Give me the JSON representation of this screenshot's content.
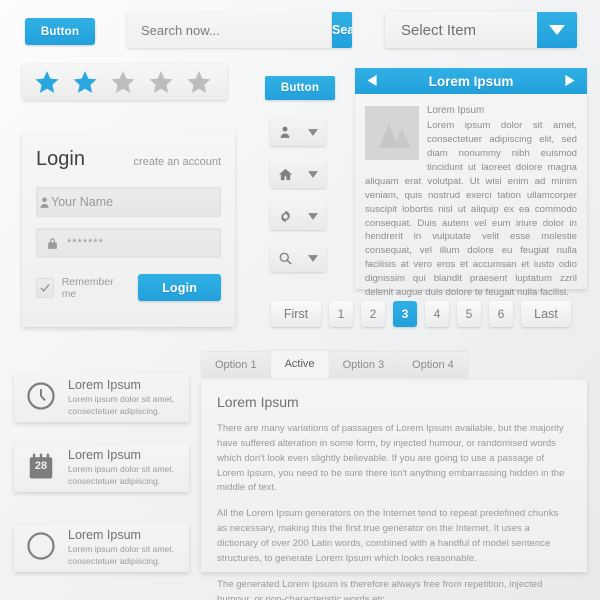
{
  "theme": {
    "accent": "#22a0db",
    "accent_light": "#31b0e4",
    "panel": "#f4f4f4",
    "text": "#8a8a8a"
  },
  "top_button": {
    "label": "Button"
  },
  "search": {
    "placeholder": "Search now...",
    "value": "",
    "button_label": "Search"
  },
  "select": {
    "value": "Select Item",
    "arrow_icon": "chevron-down-icon"
  },
  "rating": {
    "total": 5,
    "filled": 2
  },
  "second_button": {
    "label": "Button"
  },
  "login": {
    "title": "Login",
    "create_account": "create an account",
    "username": {
      "placeholder": "Your Name",
      "value": "",
      "icon": "user-icon"
    },
    "password": {
      "placeholder": "",
      "value": "*******",
      "icon": "lock-icon"
    },
    "remember_label": "Remember me",
    "remember_checked": true,
    "submit_label": "Login"
  },
  "icon_dropdowns": [
    {
      "icon": "user-icon",
      "name": "user-dropdown"
    },
    {
      "icon": "home-icon",
      "name": "home-dropdown"
    },
    {
      "icon": "gear-icon",
      "name": "settings-dropdown"
    },
    {
      "icon": "search-icon",
      "name": "search-dropdown"
    }
  ],
  "carousel": {
    "title": "Lorem Ipsum",
    "prev_icon": "caret-left-icon",
    "next_icon": "caret-right-icon",
    "item_title": "Lorem Ipsum",
    "lead": "Lorem ipsum dolor sit amet, consectetuer adipiscing elit, sed diam nonummy nibh euismod tincidunt ut laoreet dolore magna",
    "body": "aliquam erat volutpat. Ut wisi enim ad minim veniam, quis nostrud exerci tation ullamcorper suscipit lobortis nisl ut aliquip ex ea commodo consequat. Duis autem vel eum iriure dolor in hendrerit in vulputate velit esse molestie consequat, vel illum dolore eu feugiat nulla facilisis at vero eros et accumsan et iusto odio dignissim qui blandit praesent luptatum zzril delenit augue duis dolore te feugait nulla facilisi."
  },
  "pagination": {
    "first_label": "First",
    "last_label": "Last",
    "pages": [
      "1",
      "2",
      "3",
      "4",
      "5",
      "6"
    ],
    "active": "3"
  },
  "media_list": [
    {
      "icon": "clock-icon",
      "title": "Lorem Ipsum",
      "desc": "Lorem ipsum dolor sit amet, consectetuer adipiscing."
    },
    {
      "icon": "calendar-icon",
      "badge": "28",
      "title": "Lorem Ipsum",
      "desc": "Lorem ipsum dolor sit amet, consectetuer adipiscing."
    },
    {
      "icon": "compass-icon",
      "title": "Lorem Ipsum",
      "desc": "Lorem ipsum dolor sit amet, consectetuer adipiscing."
    }
  ],
  "tabs": {
    "items": [
      {
        "label": "Option 1",
        "active": false
      },
      {
        "label": "Active",
        "active": true
      },
      {
        "label": "Option 3",
        "active": false
      },
      {
        "label": "Option 4",
        "active": false
      }
    ],
    "heading": "Lorem Ipsum",
    "paragraphs": [
      "There are many variations of passages of Lorem Ipsum available, but the majority have suffered alteration in some form, by injected humour, or randomised words which don't look even slightly believable. If you are going to use a passage of Lorem Ipsum, you need to be sure there isn't anything embarrassing hidden in the middle of text.",
      "All the Lorem Ipsum generators on the Internet tend to repeat predefined chunks as necessary, making this the first true generator on the Internet. It uses a dictionary of over 200 Latin words, combined with a handful of model sentence structures, to generate Lorem Ipsum which looks reasonable.",
      "The generated Lorem Ipsum is therefore always free from repetition, injected humour, or non-characteristic words etc."
    ]
  }
}
